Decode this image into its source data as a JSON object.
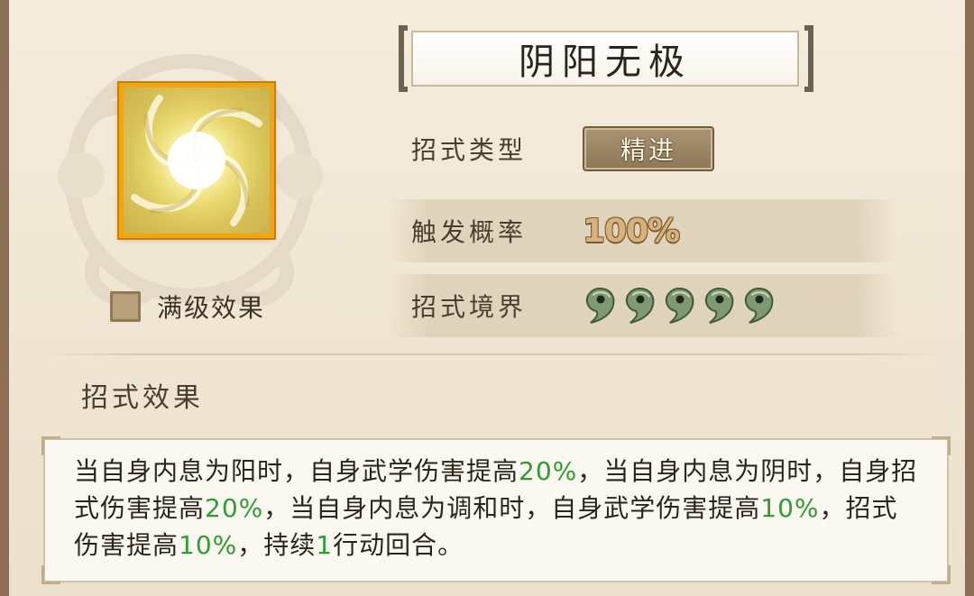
{
  "skill": {
    "name": "阴阳无极",
    "icon": "yin-yang-swirl-icon"
  },
  "max_level": {
    "label": "满级效果",
    "checked": false
  },
  "attributes": {
    "type_label": "招式类型",
    "type_value": "精进",
    "rate_label": "触发概率",
    "rate_value": "100%",
    "realm_label": "招式境界",
    "realm_level": 5,
    "realm_icon": "magatama-icon"
  },
  "effect": {
    "section_title": "招式效果",
    "segments": [
      {
        "text": "当自身内息为阳时，自身武学伤害提高"
      },
      {
        "text": "20%",
        "highlight": true
      },
      {
        "text": "，当自身内息为阴时，自身招式伤害提高"
      },
      {
        "text": "20%",
        "highlight": true
      },
      {
        "text": "，当自身内息为调和时，自身武学伤害提高"
      },
      {
        "text": "10%",
        "highlight": true
      },
      {
        "text": "，招式伤害提高"
      },
      {
        "text": "10%",
        "highlight": true
      },
      {
        "text": "，持续"
      },
      {
        "text": "1",
        "highlight": true
      },
      {
        "text": "行动回合。"
      }
    ]
  },
  "colors": {
    "highlight": "#2f9e2f",
    "icon_border": "#f0a514",
    "frame": "#8a6f55"
  }
}
